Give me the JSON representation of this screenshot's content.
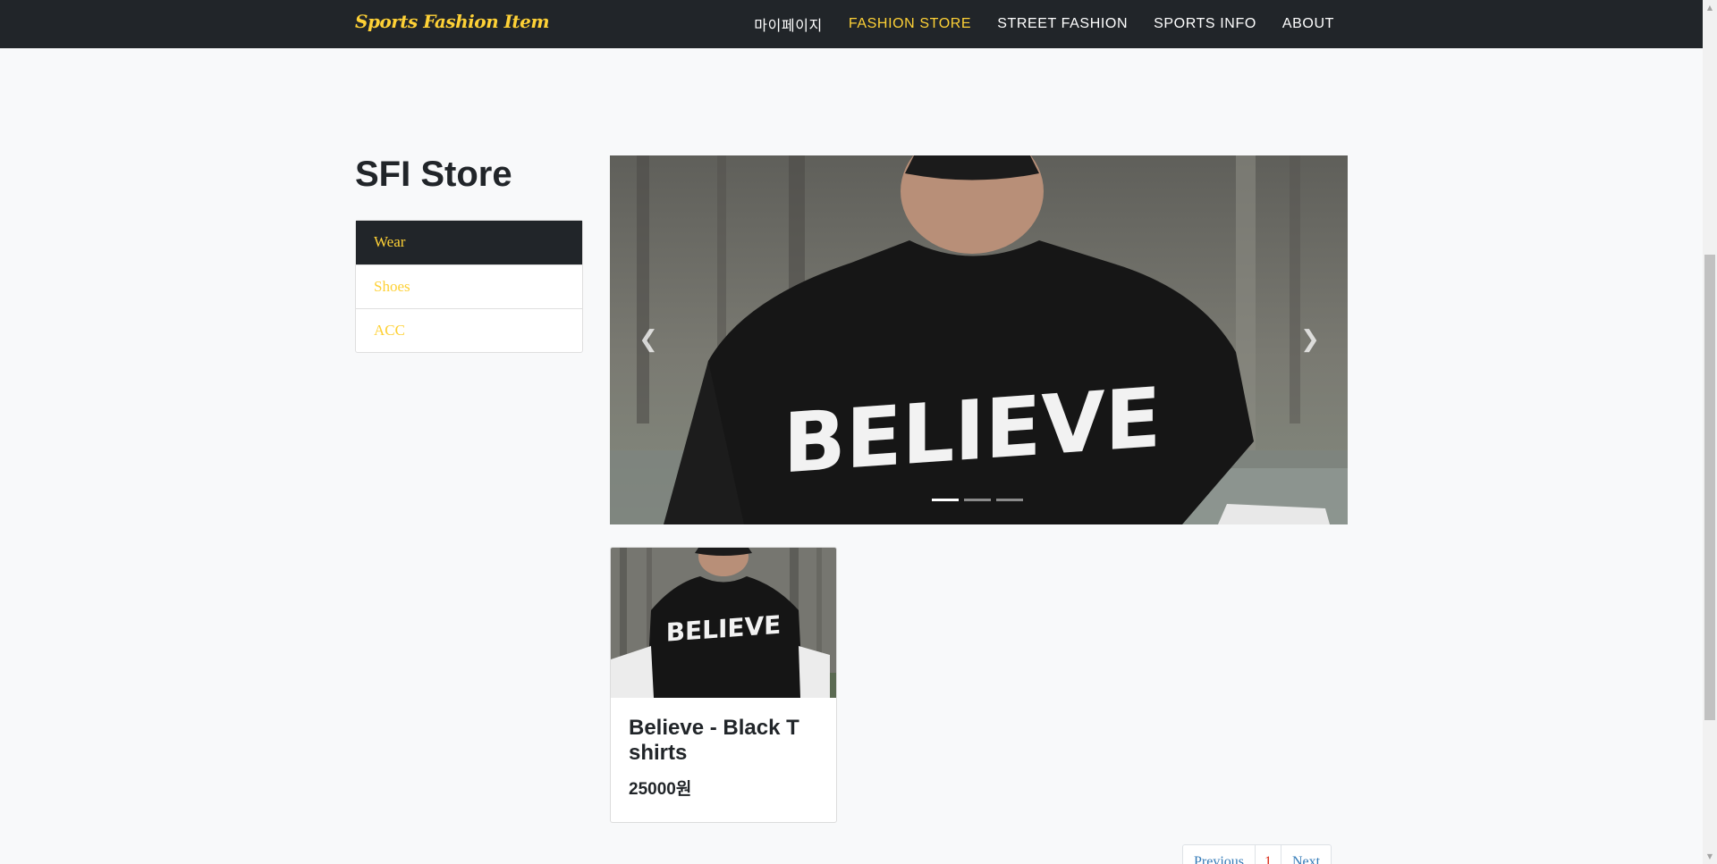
{
  "navbar": {
    "brand": "Sports Fashion Item",
    "links": [
      {
        "label": "마이페이지",
        "active": false
      },
      {
        "label": "FASHION STORE",
        "active": true
      },
      {
        "label": "STREET FASHION",
        "active": false
      },
      {
        "label": "SPORTS INFO",
        "active": false
      },
      {
        "label": "ABOUT",
        "active": false
      }
    ]
  },
  "sidebar": {
    "title": "SFI Store",
    "categories": [
      {
        "label": "Wear",
        "active": true
      },
      {
        "label": "Shoes",
        "active": false
      },
      {
        "label": "ACC",
        "active": false
      }
    ]
  },
  "carousel": {
    "slide_text": "BELIEVE",
    "indicator_count": 3,
    "active_index": 0,
    "prev_icon": "chevron-left-icon",
    "next_icon": "chevron-right-icon"
  },
  "products": [
    {
      "name": "Believe - Black T shirts",
      "price": "25000원",
      "image_text": "BELIEVE"
    }
  ],
  "pagination": {
    "previous": "Previous",
    "current": "1",
    "next": "Next"
  },
  "colors": {
    "navbar_bg": "#212529",
    "accent": "#fed136",
    "page_bg": "#f8f9fa",
    "link": "#337ab7",
    "current_page": "#d9230f"
  }
}
